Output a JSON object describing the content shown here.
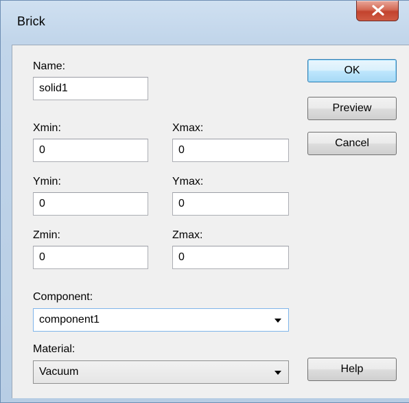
{
  "window": {
    "title": "Brick",
    "close_glyph": "X"
  },
  "form": {
    "name_label": "Name:",
    "name_value": "solid1",
    "xmin_label": "Xmin:",
    "xmin_value": "0",
    "xmax_label": "Xmax:",
    "xmax_value": "0",
    "ymin_label": "Ymin:",
    "ymin_value": "0",
    "ymax_label": "Ymax:",
    "ymax_value": "0",
    "zmin_label": "Zmin:",
    "zmin_value": "0",
    "zmax_label": "Zmax:",
    "zmax_value": "0",
    "component_label": "Component:",
    "component_value": "component1",
    "material_label": "Material:",
    "material_value": "Vacuum"
  },
  "buttons": {
    "ok": "OK",
    "preview": "Preview",
    "cancel": "Cancel",
    "help": "Help"
  },
  "colors": {
    "close_button": "#c7432f",
    "default_button_border": "#3c7fb1",
    "dialog_background": "#f0f0f0"
  }
}
